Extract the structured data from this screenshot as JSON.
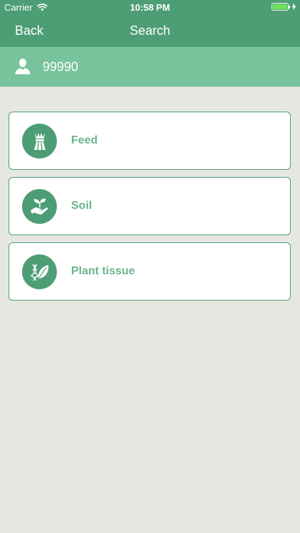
{
  "status_bar": {
    "carrier": "Carrier",
    "time": "10:58 PM",
    "battery_level": 1.0
  },
  "nav": {
    "back_label": "Back",
    "title": "Search"
  },
  "user": {
    "id": "99990",
    "icon": "user-icon"
  },
  "categories": [
    {
      "label": "Feed",
      "icon": "wheat-bundle-icon"
    },
    {
      "label": "Soil",
      "icon": "hand-sprout-icon"
    },
    {
      "label": "Plant tissue",
      "icon": "dna-leaf-icon"
    }
  ],
  "colors": {
    "header": "#4d9d75",
    "subheader": "#78c39b",
    "background": "#e7e7e2",
    "card_border": "#4d9d75",
    "label": "#6ab58d"
  }
}
